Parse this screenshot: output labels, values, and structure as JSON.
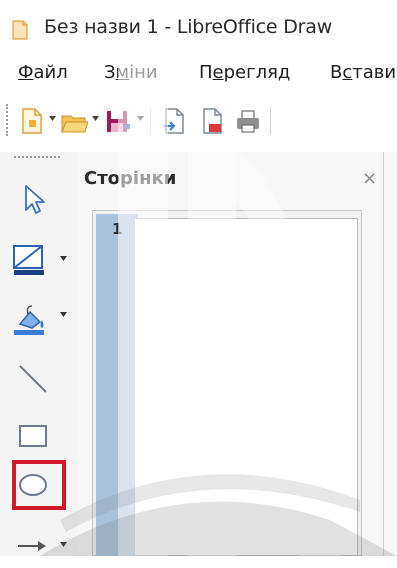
{
  "window": {
    "title": "Без назви 1 - LibreOffice Draw"
  },
  "menubar": {
    "items": [
      {
        "label_prefix": "",
        "mnemonic": "Ф",
        "label_rest": "айл"
      },
      {
        "label_prefix": "З",
        "mnemonic": "м",
        "label_rest": "іни"
      },
      {
        "label_prefix": "П",
        "mnemonic": "е",
        "label_rest": "регляд"
      },
      {
        "label_prefix": "В",
        "mnemonic": "с",
        "label_rest": "тави"
      }
    ]
  },
  "toolbar": {
    "buttons": [
      "new-icon",
      "open-icon",
      "save-icon",
      "export-icon",
      "export-pdf-icon",
      "print-icon"
    ]
  },
  "left_tools": {
    "buttons": [
      "select-icon",
      "line-color-icon",
      "fill-color-icon",
      "line-icon",
      "rectangle-icon",
      "ellipse-icon",
      "arrow-icon"
    ],
    "highlighted": "ellipse-icon",
    "highlight_color": "#d0182a"
  },
  "pages_panel": {
    "title": "Сторінки",
    "close_glyph": "×",
    "page_number": "1",
    "selection_color": "#a9c2dc"
  }
}
